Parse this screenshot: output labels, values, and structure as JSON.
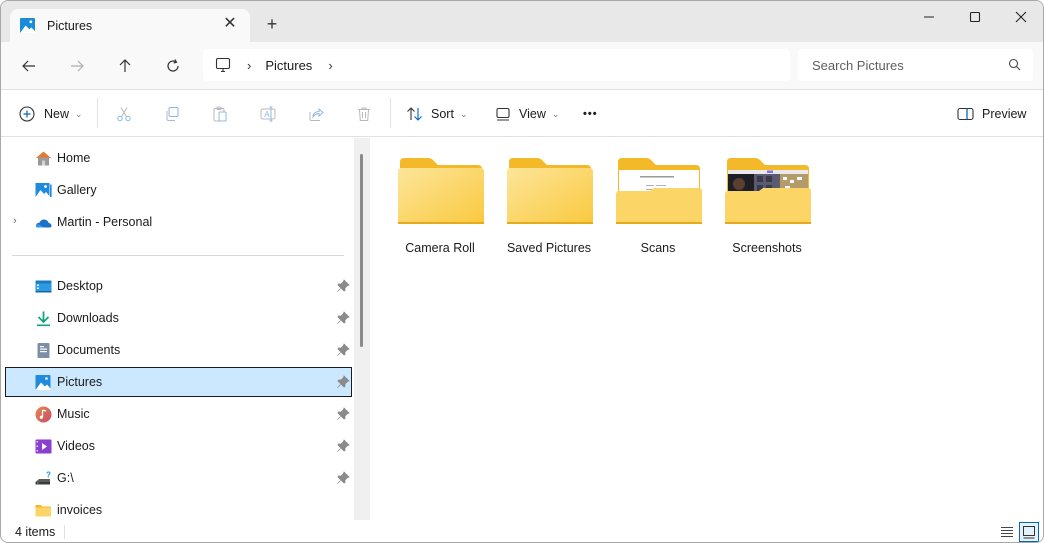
{
  "window": {
    "tab_title": "Pictures",
    "tab_icon": "pictures-icon",
    "controls": {
      "minimize": "minimize-icon",
      "maximize": "maximize-icon",
      "close": "close-icon"
    }
  },
  "nav": {
    "back": "arrow-left-icon",
    "forward": "arrow-right-icon",
    "up": "arrow-up-icon",
    "refresh": "refresh-icon",
    "breadcrumb": [
      {
        "label": "",
        "icon": "this-pc-icon"
      },
      {
        "label": "Pictures"
      }
    ],
    "search_placeholder": "Search Pictures",
    "search_value": ""
  },
  "commandbar": {
    "new_label": "New",
    "sort_label": "Sort",
    "view_label": "View",
    "more_label": "•••",
    "preview_label": "Preview",
    "actions": [
      "cut",
      "copy",
      "paste",
      "rename",
      "share",
      "delete"
    ]
  },
  "sidebar": {
    "top_items": [
      {
        "label": "Home",
        "icon": "home-icon"
      },
      {
        "label": "Gallery",
        "icon": "gallery-icon"
      },
      {
        "label": "Martin - Personal",
        "icon": "onedrive-icon",
        "expandable": true
      }
    ],
    "pinned_items": [
      {
        "label": "Desktop",
        "icon": "desktop-icon",
        "pinned": true
      },
      {
        "label": "Downloads",
        "icon": "downloads-icon",
        "pinned": true
      },
      {
        "label": "Documents",
        "icon": "documents-icon",
        "pinned": true
      },
      {
        "label": "Pictures",
        "icon": "pictures-icon",
        "pinned": true,
        "selected": true
      },
      {
        "label": "Music",
        "icon": "music-icon",
        "pinned": true
      },
      {
        "label": "Videos",
        "icon": "videos-icon",
        "pinned": true
      },
      {
        "label": "G:\\",
        "icon": "network-drive-icon",
        "pinned": true
      },
      {
        "label": "invoices",
        "icon": "folder-icon",
        "pinned": false
      }
    ]
  },
  "content": {
    "items": [
      {
        "name": "Camera Roll",
        "type": "folder",
        "preview": "empty"
      },
      {
        "name": "Saved Pictures",
        "type": "folder",
        "preview": "empty"
      },
      {
        "name": "Scans",
        "type": "folder",
        "preview": "document"
      },
      {
        "name": "Screenshots",
        "type": "folder",
        "preview": "images"
      }
    ]
  },
  "statusbar": {
    "item_count": "4 items",
    "view_modes": [
      "details",
      "large-icons"
    ],
    "active_view": "large-icons"
  },
  "colors": {
    "accent": "#0067c0",
    "selection_bg": "#cce8ff",
    "folder_back": "#f4b929",
    "folder_front": "#fcd567"
  }
}
